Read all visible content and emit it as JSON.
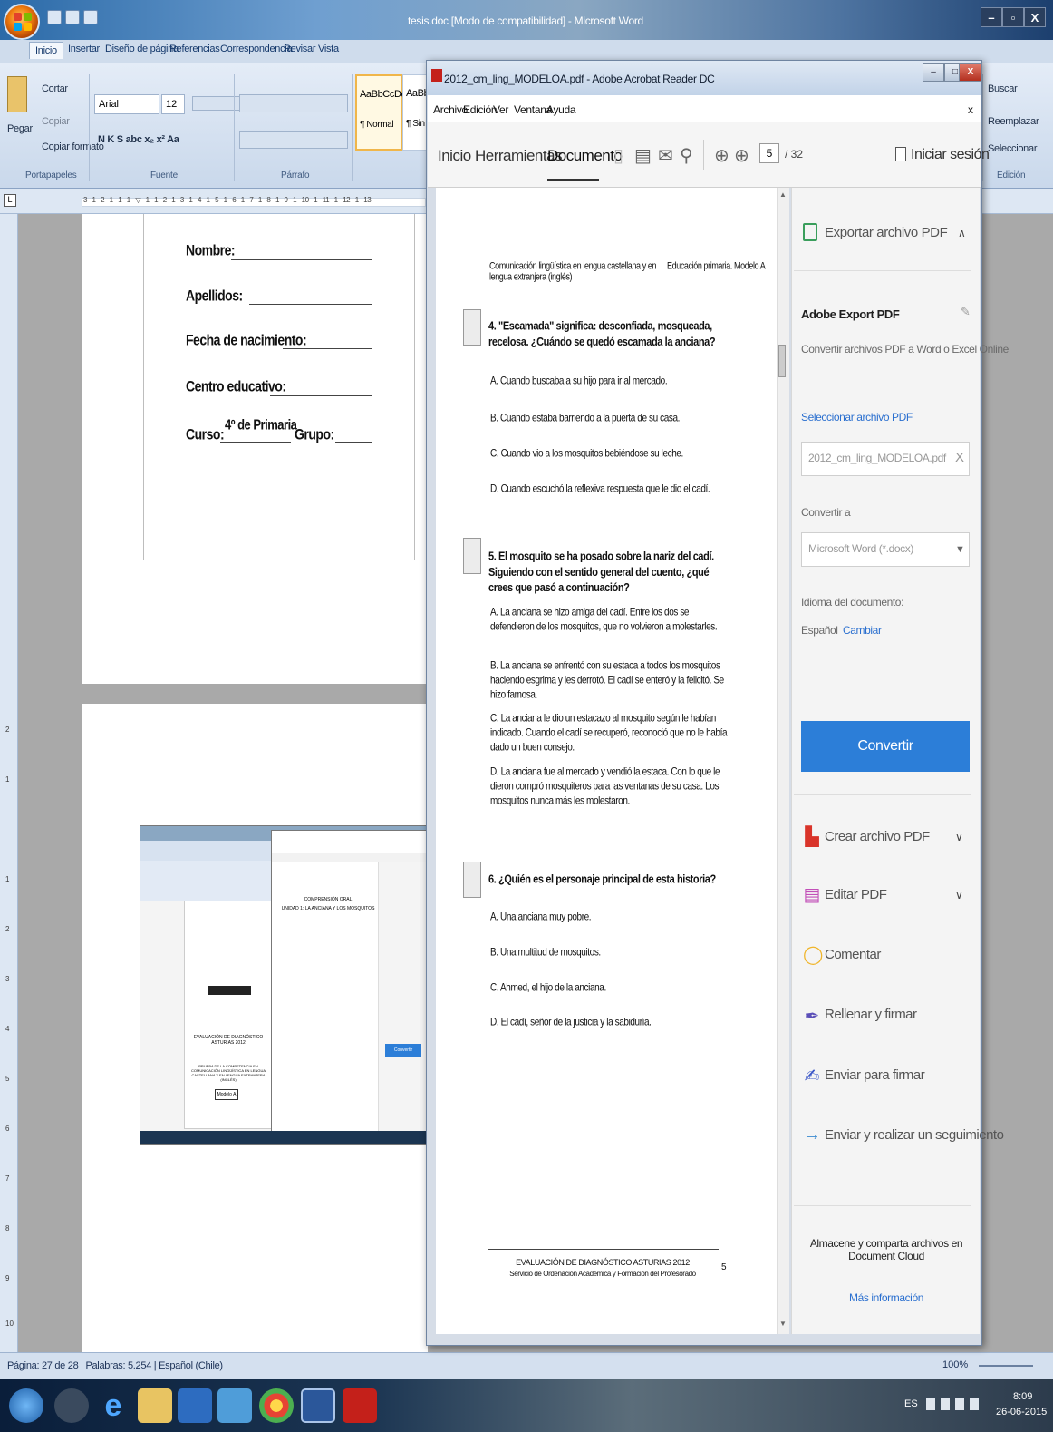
{
  "word": {
    "title": "tesis.doc [Modo de compatibilidad] - Microsoft Word",
    "tabs": [
      "Inicio",
      "Insertar",
      "Diseño de página",
      "Referencias",
      "Correspondencia",
      "Revisar",
      "Vista"
    ],
    "clipboard": {
      "paste": "Pegar",
      "cut": "Cortar",
      "copy": "Copiar",
      "format_painter": "Copiar formato",
      "group": "Portapapeles"
    },
    "font": {
      "name": "Arial",
      "size": "12",
      "group": "Fuente",
      "format_row": "N  K  S  abc  x₂  x²  Aa"
    },
    "paragraph_group": "Párrafo",
    "styles": [
      {
        "preview": "AaBbCcDc",
        "name": "¶ Normal"
      },
      {
        "preview": "AaBbCcD",
        "name": "¶ Sin espa..."
      }
    ],
    "editing": {
      "find": "Buscar",
      "replace": "Reemplazar",
      "select": "Seleccionar",
      "group": "Edición"
    },
    "ruler_text": "3 · 1 · 2 · 1 · 1 · 1 · ▽ · 1 · 1 · 2 · 1 · 3 · 1 · 4 · 1 · 5 · 1 · 6 · 1 · 7 · 1 · 8 · 1 · 9 · 1 · 10 · 1 · 11 · 1 · 12 · 1 · 13",
    "vruler": [
      "2",
      "1",
      "1",
      "2",
      "3",
      "4",
      "5",
      "6",
      "7",
      "8",
      "9",
      "10"
    ],
    "form": {
      "name_label": "Nombre:",
      "surname_label": "Apellidos:",
      "birth_label": "Fecha de nacimiento:",
      "school_label": "Centro educativo:",
      "course_label": "Curso:",
      "course_value": "4º de Primaria",
      "group_label": "Grupo:"
    },
    "status": "Página: 27 de 28  |  Palabras: 5.254  |  Español (Chile)",
    "zoom": "100%"
  },
  "thumbnail": {
    "title": "EVALUACIÓN DE DIAGNÓSTICO ASTURIAS 2012",
    "subtitle": "PRUEBA DE LA COMPETENCIA EN COMUNICACIÓN LINGÜÍSTICA EN LENGUA CASTELLANA Y EN LENGUA EXTRANJERA (INGLÉS)",
    "model": "Modelo A",
    "section_heading": "COMPRENSIÓN ORAL",
    "unit": "UNIDAD 1: LA ANCIANA Y LOS MOSQUITOS",
    "convert": "Convertir"
  },
  "acrobat": {
    "title": "2012_cm_ling_MODELOA.pdf - Adobe Acrobat Reader DC",
    "menu": [
      "Archivo",
      "Edición",
      "Ver",
      "Ventana",
      "Ayuda"
    ],
    "close_menu": "x",
    "tabs": [
      "Inicio",
      "Herramientas",
      "Documento"
    ],
    "page_current": "5",
    "page_total": "/ 32",
    "signin": "Iniciar sesión",
    "pdf": {
      "header_left": "Comunicación lingüística en lengua castellana y en lengua extranjera (inglés)",
      "header_right": "Educación primaria. Modelo A",
      "questions": [
        {
          "text": "4.  \"Escamada\" significa: desconfiada, mosqueada, recelosa. ¿Cuándo se quedó escamada la anciana?",
          "options": [
            "A.   Cuando buscaba a su hijo para ir al mercado.",
            "B.   Cuando estaba barriendo a la puerta de su casa.",
            "C.   Cuando vio a los mosquitos bebiéndose su leche.",
            "D.   Cuando escuchó la reflexiva respuesta que le dio el cadí."
          ]
        },
        {
          "text": "5.  El mosquito se ha posado sobre la nariz del cadí. Siguiendo con el sentido general del cuento, ¿qué crees que pasó a continuación?",
          "options": [
            "A.   La anciana se hizo amiga del cadí. Entre los dos se defendieron de los mosquitos, que no volvieron a molestarles.",
            "B.   La anciana se enfrentó con su estaca a todos los mosquitos haciendo esgrima y les derrotó. El cadí se enteró y la felicitó. Se hizo famosa.",
            "C.   La anciana le dio un estacazo al mosquito según le habían indicado. Cuando el cadí se recuperó, reconoció que no le había dado un buen consejo.",
            "D.   La anciana fue al mercado y vendió la estaca. Con lo que le dieron compró mosquiteros para las ventanas de su casa. Los mosquitos nunca más les molestaron."
          ]
        },
        {
          "text": "6.  ¿Quién es el personaje principal de esta historia?",
          "options": [
            "A.   Una anciana muy pobre.",
            "B.   Una multitud de mosquitos.",
            "C.   Ahmed, el hijo de la anciana.",
            "D.   El cadí, señor de la justicia y la sabiduría."
          ]
        }
      ],
      "footer_line1": "EVALUACIÓN DE DIAGNÓSTICO ASTURIAS 2012",
      "footer_line2": "Servicio de Ordenación Académica y Formación del Profesorado",
      "footer_page": "5"
    },
    "right_pane": {
      "export_title": "Exportar archivo PDF",
      "product": "Adobe Export PDF",
      "description": "Convertir archivos PDF a Word o Excel Online",
      "select_label": "Seleccionar archivo PDF",
      "selected_file": "2012_cm_ling_MODELOA.pdf",
      "clear": "X",
      "convert_to": "Convertir a",
      "format": "Microsoft Word (*.docx)",
      "doc_lang_label": "Idioma del documento:",
      "doc_lang": "Español",
      "change": "Cambiar",
      "convert_button": "Convertir",
      "tools": [
        "Crear archivo PDF",
        "Editar PDF",
        "Comentar",
        "Rellenar y firmar",
        "Enviar para firmar",
        "Enviar y realizar un seguimiento"
      ],
      "cloud_title": "Almacene y comparta archivos en Document Cloud",
      "more_info": "Más información"
    }
  },
  "taskbar": {
    "language": "ES",
    "time": "8:09",
    "date": "26-06-2015"
  },
  "colors": {
    "acrobat_blue": "#2c7ed8",
    "link_blue": "#2a6fcf",
    "word_blue": "#2b6aa8"
  }
}
